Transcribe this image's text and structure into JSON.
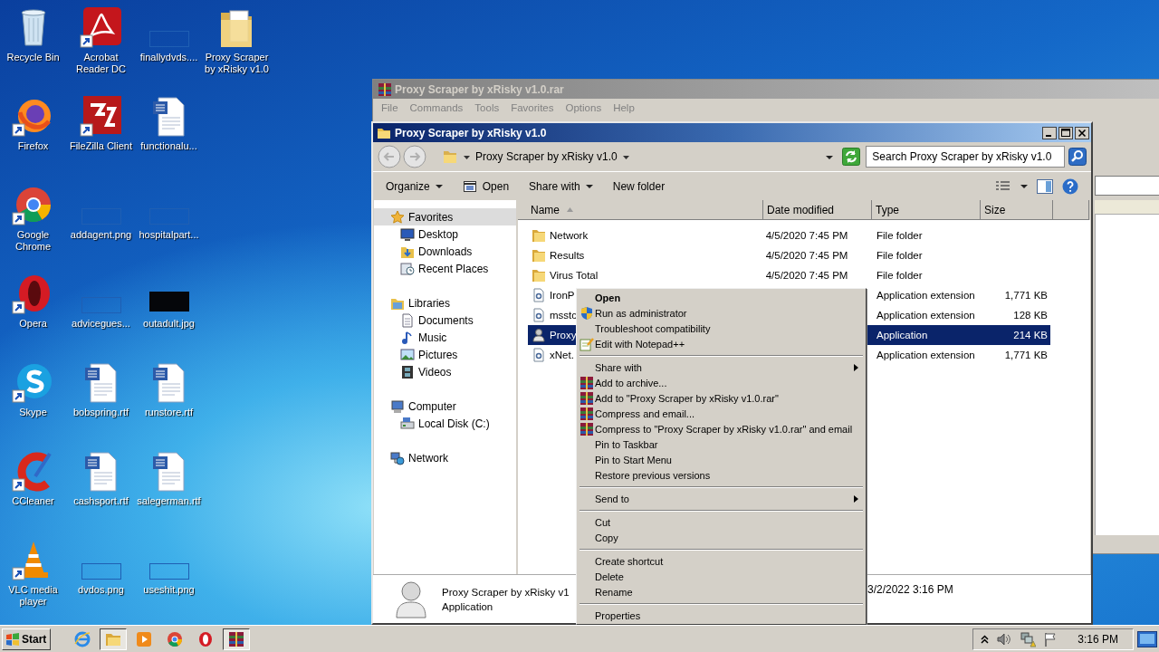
{
  "desktop": {
    "icons": [
      {
        "label": "Recycle Bin",
        "kind": "recycle",
        "shortcut": false
      },
      {
        "label": "Firefox",
        "kind": "firefox",
        "shortcut": true
      },
      {
        "label": "Google\nChrome",
        "kind": "chrome",
        "shortcut": true
      },
      {
        "label": "Opera",
        "kind": "opera",
        "shortcut": true
      },
      {
        "label": "Skype",
        "kind": "skype",
        "shortcut": true
      },
      {
        "label": "CCleaner",
        "kind": "ccleaner",
        "shortcut": true
      },
      {
        "label": "VLC media\nplayer",
        "kind": "vlc",
        "shortcut": true
      },
      {
        "label": "Acrobat\nReader DC",
        "kind": "pdf",
        "shortcut": true
      },
      {
        "label": "FileZilla Client",
        "kind": "filezilla",
        "shortcut": true
      },
      {
        "label": "addagent.png",
        "kind": "thumb",
        "shortcut": false
      },
      {
        "label": "advicegues...",
        "kind": "thumb",
        "shortcut": false
      },
      {
        "label": "bobspring.rtf",
        "kind": "word",
        "shortcut": false
      },
      {
        "label": "cashsport.rtf",
        "kind": "word",
        "shortcut": false
      },
      {
        "label": "dvdos.png",
        "kind": "thumb",
        "shortcut": false
      },
      {
        "label": "finallydvds....",
        "kind": "thumb",
        "shortcut": false
      },
      {
        "label": "functionalu...",
        "kind": "word",
        "shortcut": false
      },
      {
        "label": "hospitalpart...",
        "kind": "thumb",
        "shortcut": false
      },
      {
        "label": "outadult.jpg",
        "kind": "dark",
        "shortcut": false
      },
      {
        "label": "runstore.rtf",
        "kind": "word",
        "shortcut": false
      },
      {
        "label": "salegerman.rtf",
        "kind": "word",
        "shortcut": false
      },
      {
        "label": "useshit.png",
        "kind": "thumb",
        "shortcut": false
      },
      {
        "label": "Proxy Scraper\nby xRisky v1.0",
        "kind": "folder",
        "shortcut": false
      }
    ]
  },
  "archiver_window": {
    "title": "Proxy Scraper by xRisky v1.0.rar",
    "menu": [
      "File",
      "Commands",
      "Tools",
      "Favorites",
      "Options",
      "Help"
    ]
  },
  "explorer_window": {
    "title": "Proxy Scraper by xRisky v1.0",
    "address": {
      "path": "Proxy Scraper by xRisky v1.0"
    },
    "search": {
      "placeholder": "Search Proxy Scraper by xRisky v1.0"
    },
    "toolbar": [
      {
        "label": "Organize",
        "kind": "dropdown"
      },
      {
        "label": "Open",
        "kind": "open"
      },
      {
        "label": "Share with",
        "kind": "dropdown"
      },
      {
        "label": "New folder",
        "kind": "button"
      }
    ],
    "navigation": [
      {
        "kind": "favorites",
        "label": "Favorites",
        "selected": true,
        "children": [
          {
            "kind": "desktop",
            "label": "Desktop",
            "selected": false
          },
          {
            "kind": "downloads",
            "label": "Downloads",
            "selected": false
          },
          {
            "kind": "recent",
            "label": "Recent Places",
            "selected": false
          }
        ]
      },
      {
        "kind": "libraries",
        "label": "Libraries",
        "selected": false,
        "children": [
          {
            "kind": "documents",
            "label": "Documents",
            "selected": false
          },
          {
            "kind": "music",
            "label": "Music",
            "selected": false
          },
          {
            "kind": "pictures",
            "label": "Pictures",
            "selected": false
          },
          {
            "kind": "videos",
            "label": "Videos",
            "selected": false
          }
        ]
      },
      {
        "kind": "computer",
        "label": "Computer",
        "selected": false,
        "children": [
          {
            "kind": "drive",
            "label": "Local Disk (C:)",
            "selected": false
          }
        ]
      },
      {
        "kind": "network",
        "label": "Network",
        "selected": false
      }
    ],
    "columns": [
      {
        "label": "Name",
        "sorted": true
      },
      {
        "label": "Date modified",
        "sorted": false
      },
      {
        "label": "Type",
        "sorted": false
      },
      {
        "label": "Size",
        "sorted": false
      }
    ],
    "files": [
      {
        "kind": "folder",
        "name": "Network",
        "date_modified": "4/5/2020 7:45 PM",
        "type": "File folder",
        "selected": false
      },
      {
        "kind": "folder",
        "name": "Results",
        "date_modified": "4/5/2020 7:45 PM",
        "type": "File folder",
        "selected": false
      },
      {
        "kind": "folder",
        "name": "Virus Total",
        "date_modified": "4/5/2020 7:45 PM",
        "type": "File folder",
        "selected": false
      },
      {
        "kind": "extension",
        "name": "IronP",
        "type": "Application extension",
        "size": "1,771 KB",
        "selected": false
      },
      {
        "kind": "extension",
        "name": "msstc",
        "type": "Application extension",
        "size": "128 KB",
        "selected": false
      },
      {
        "kind": "application",
        "name": "Proxy",
        "type": "Application",
        "size": "214 KB",
        "selected": true
      },
      {
        "kind": "extension",
        "name": "xNet.",
        "type": "Application extension",
        "size": "1,771 KB",
        "selected": false
      }
    ],
    "details": {
      "name": "Proxy Scraper by xRisky v1",
      "type": "Application",
      "date": "3/2/2022 3:16 PM"
    }
  },
  "context_menu": [
    {
      "kind": "default",
      "label": "Open"
    },
    {
      "kind": "admin",
      "label": "Run as administrator"
    },
    {
      "kind": "item",
      "label": "Troubleshoot compatibility"
    },
    {
      "kind": "editor",
      "label": "Edit with Notepad++"
    },
    {
      "kind": "separator"
    },
    {
      "kind": "submenu",
      "label": "Share with"
    },
    {
      "kind": "archive",
      "label": "Add to archive..."
    },
    {
      "kind": "archive",
      "label": "Add to \"Proxy Scraper by xRisky v1.0.rar\""
    },
    {
      "kind": "archive",
      "label": "Compress and email..."
    },
    {
      "kind": "archive",
      "label": "Compress to \"Proxy Scraper by xRisky v1.0.rar\" and email"
    },
    {
      "kind": "item",
      "label": "Pin to Taskbar"
    },
    {
      "kind": "item",
      "label": "Pin to Start Menu"
    },
    {
      "kind": "item",
      "label": "Restore previous versions"
    },
    {
      "kind": "separator"
    },
    {
      "kind": "submenu",
      "label": "Send to"
    },
    {
      "kind": "separator"
    },
    {
      "kind": "item",
      "label": "Cut"
    },
    {
      "kind": "item",
      "label": "Copy"
    },
    {
      "kind": "separator"
    },
    {
      "kind": "item",
      "label": "Create shortcut"
    },
    {
      "kind": "item",
      "label": "Delete"
    },
    {
      "kind": "item",
      "label": "Rename"
    },
    {
      "kind": "separator"
    },
    {
      "kind": "item",
      "label": "Properties"
    }
  ],
  "taskbar": {
    "start": "Start",
    "apps": [
      {
        "kind": "ie",
        "active": false
      },
      {
        "kind": "explorer",
        "active": true
      },
      {
        "kind": "media",
        "active": false
      },
      {
        "kind": "chrome",
        "active": false
      },
      {
        "kind": "opera",
        "active": false
      },
      {
        "kind": "archiver",
        "active": true
      }
    ],
    "clock": "3:16 PM"
  }
}
